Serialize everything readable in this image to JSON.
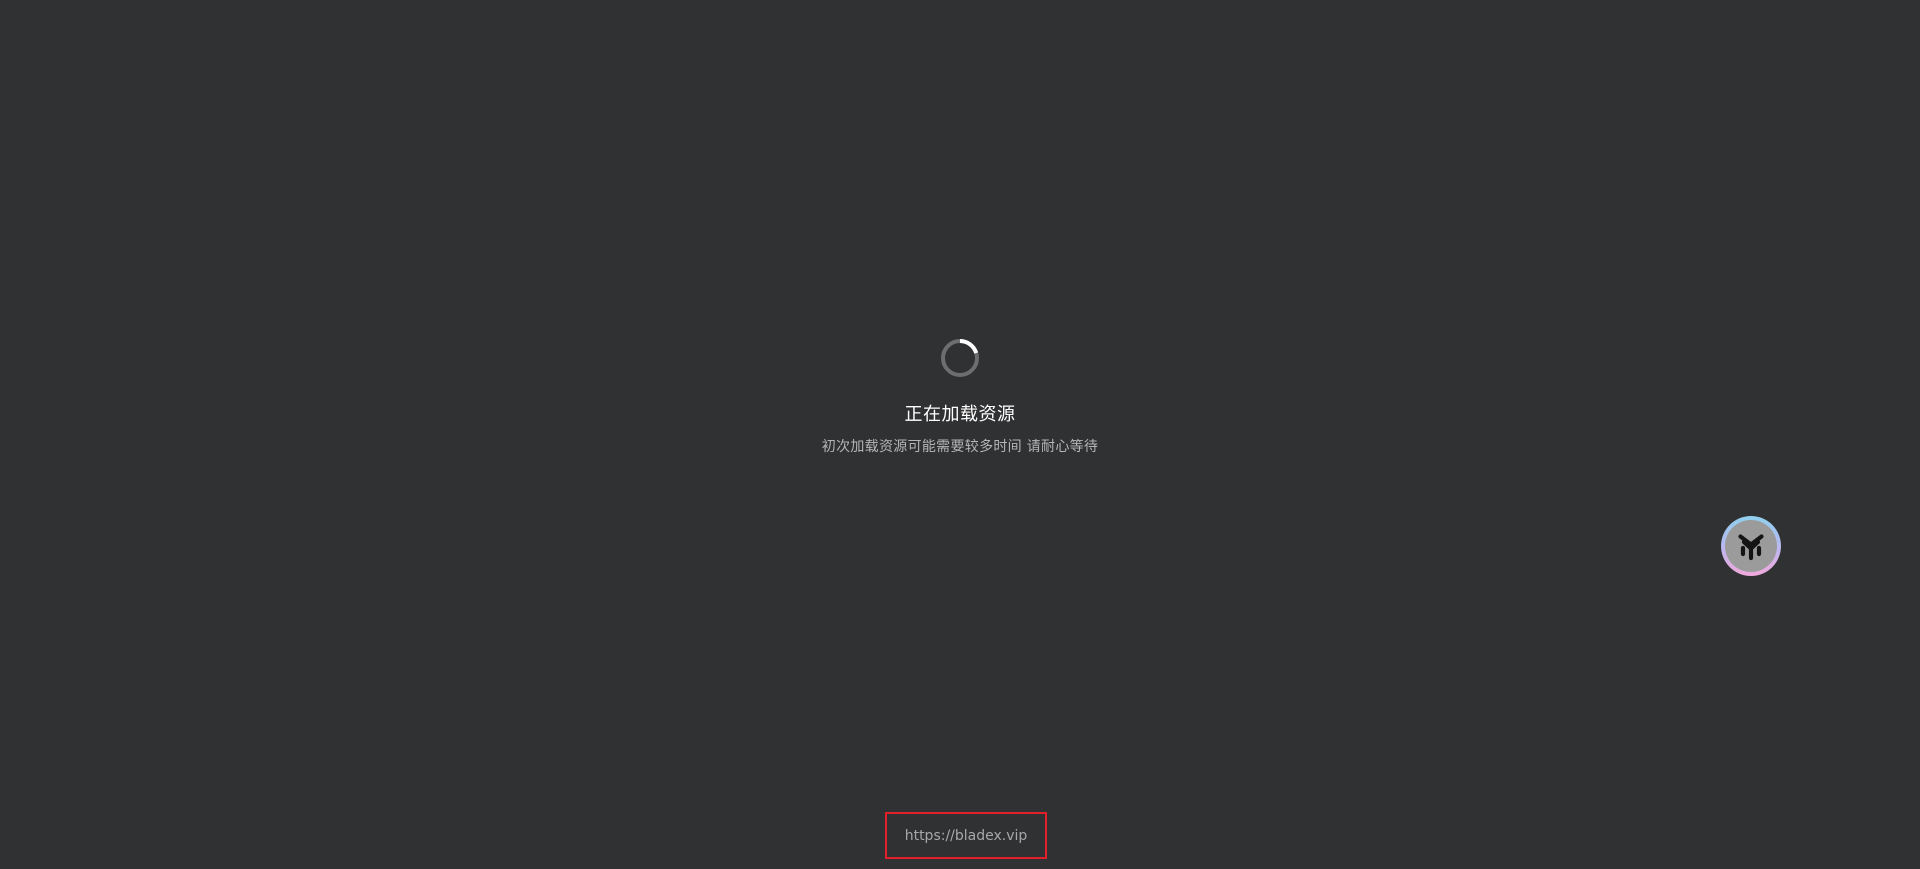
{
  "loader": {
    "icon": "loading-spinner-icon",
    "title": "正在加载资源",
    "subtitle": "初次加载资源可能需要较多时间 请耐心等待"
  },
  "assistant": {
    "icon": "assistant-logo-icon"
  },
  "footer": {
    "link_text": "https://bladex.vip"
  },
  "colors": {
    "background": "#303133",
    "title": "#ffffff",
    "subtitle": "#b5b5b5",
    "highlight_border": "#e3202a"
  }
}
